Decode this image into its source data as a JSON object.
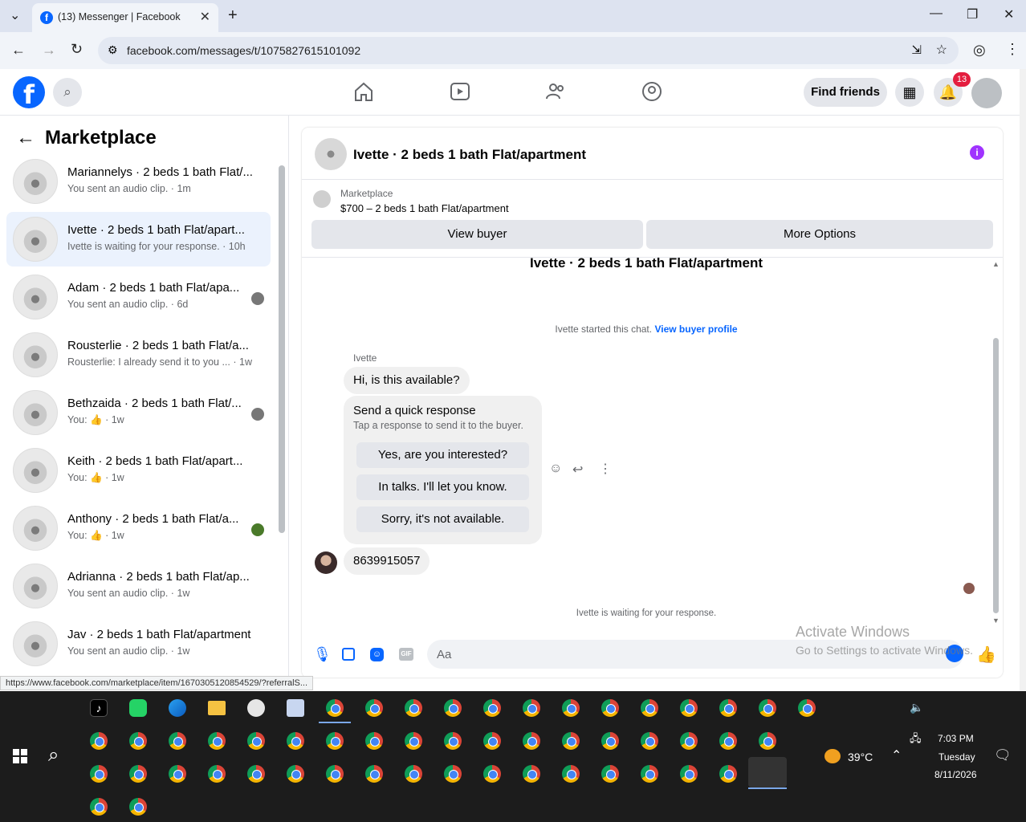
{
  "browser": {
    "tab_title": "(13) Messenger | Facebook",
    "url": "facebook.com/messages/t/1075827615101092",
    "status_url": "https://www.facebook.com/marketplace/item/1670305120854529/?referralS..."
  },
  "fb_header": {
    "find_friends": "Find friends",
    "notification_count": "13"
  },
  "sidebar": {
    "title": "Marketplace",
    "conversations": [
      {
        "name": "Mariannelys · 2 beds 1 bath Flat/...",
        "preview": "You sent an audio clip. · 1m"
      },
      {
        "name": "Ivette · 2 beds 1 bath Flat/apart...",
        "preview": "Ivette is waiting for your response. · 10h"
      },
      {
        "name": "Adam · 2 beds 1 bath Flat/apa...",
        "preview": "You sent an audio clip. · 6d"
      },
      {
        "name": "Rousterlie · 2 beds 1 bath Flat/a...",
        "preview": "Rousterlie: I already send it to you ... · 1w"
      },
      {
        "name": "Bethzaida · 2 beds 1 bath Flat/...",
        "preview": "You: 👍 · 1w"
      },
      {
        "name": "Keith · 2 beds 1 bath Flat/apart...",
        "preview": "You: 👍 · 1w"
      },
      {
        "name": "Anthony · 2 beds 1 bath Flat/a...",
        "preview": "You: 👍 · 1w"
      },
      {
        "name": "Adrianna · 2 beds 1 bath Flat/ap...",
        "preview": "You sent an audio clip. · 1w"
      },
      {
        "name": "Jav · 2 beds 1 bath Flat/apartment",
        "preview": "You sent an audio clip. · 1w"
      }
    ]
  },
  "chat": {
    "header_title": "Ivette · 2 beds 1 bath Flat/apartment",
    "listing_source": "Marketplace",
    "listing_title": "$700 – 2 beds 1 bath Flat/apartment",
    "view_buyer": "View buyer",
    "more_options": "More Options",
    "thread_title": "Ivette · 2 beds 1 bath Flat/apartment",
    "started_text": "Ivette started this chat.",
    "view_buyer_profile": "View buyer profile",
    "sender_name": "Ivette",
    "message1": "Hi, is this available?",
    "quick_title": "Send a quick response",
    "quick_sub": "Tap a response to send it to the buyer.",
    "quick_responses": [
      "Yes, are you interested?",
      "In talks. I'll let you know.",
      "Sorry, it's not available."
    ],
    "message2": "8639915057",
    "waiting_text": "Ivette is waiting for your response.",
    "input_placeholder": "Aa",
    "watermark_line1": "Activate Windows",
    "watermark_line2": "Go to Settings to activate Windows."
  },
  "taskbar": {
    "weather": "39°C",
    "time": "7:03 PM",
    "day": "Tuesday",
    "date": "8/11/2026"
  }
}
